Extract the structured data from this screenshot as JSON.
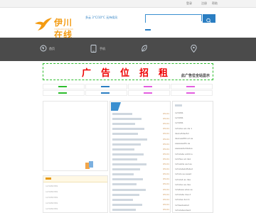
{
  "topbar": {
    "links": [
      "登录",
      "注册",
      "帮助"
    ]
  },
  "brand": {
    "name": "伊川在线",
    "slogan": "YICHUAN ZAIXIAN",
    "accent": "#f39b12"
  },
  "weather": {
    "text": "多云 3°C/10°C  无持续风"
  },
  "search": {
    "placeholder": ""
  },
  "nav": {
    "items": [
      {
        "icon": "globe-icon",
        "label": "首页"
      },
      {
        "icon": "mobile-icon",
        "label": "手机"
      },
      {
        "icon": "leaf-icon",
        "label": "生活"
      },
      {
        "icon": "map-pin-icon",
        "label": "地图"
      }
    ]
  },
  "ad": {
    "title": "广告位招租",
    "sub1": "此广告位全站显示",
    "sub2": ""
  },
  "ad_colors": {
    "border": "#2dbd2d",
    "title": "#e00000"
  },
  "main": {
    "list": [
      {
        "date": "05-01"
      },
      {
        "date": "05-01"
      },
      {
        "date": "05-01"
      },
      {
        "date": "05-01"
      },
      {
        "date": "05-01"
      },
      {
        "date": "05-01"
      },
      {
        "date": "05-01"
      },
      {
        "date": "05-01"
      },
      {
        "date": "05-01"
      },
      {
        "date": "05-01"
      },
      {
        "date": "05-01"
      },
      {
        "date": "05-01"
      },
      {
        "date": "05-01"
      },
      {
        "date": "05-01"
      },
      {
        "date": "05-01"
      },
      {
        "date": "05-01"
      },
      {
        "date": "05-01"
      },
      {
        "date": "05-01"
      },
      {
        "date": "05-01"
      },
      {
        "date": "05-01"
      }
    ]
  },
  "left_list": [
    "123456789",
    "123456789",
    "123456789",
    "123456789",
    "123456789"
  ],
  "right_list": [
    "123456",
    "123456",
    "123456",
    "1212sa aio da 1",
    "4ss1a54ss5d",
    "4ss1ea456 sd as",
    "saaaaasdfs as",
    "saaaas4sd4a1ss",
    "1212a4a a4d4 a",
    "1223sa a4 da1",
    "121a4da asd as",
    "1212a4ab4fs4sd",
    "1212a sa ssasd",
    "1212a4 as dsa",
    "1212sa aa dsa",
    "12a4saa sdas ss",
    "1212a4a dsa d",
    "1212aa dsd 4",
    "123asdsa4sd",
    "1212a4asdsa4"
  ]
}
